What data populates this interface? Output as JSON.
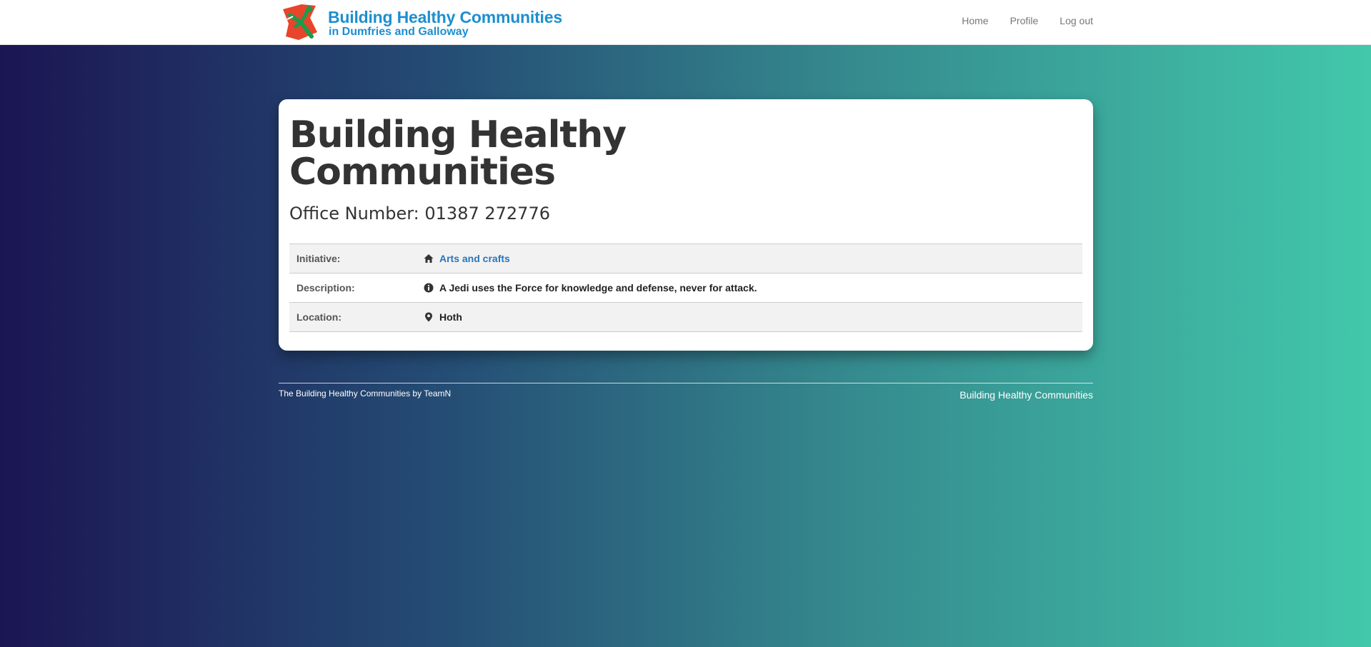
{
  "header": {
    "brand_line1": "Building Healthy Communities",
    "brand_line2": "in Dumfries and Galloway",
    "logo_icon": "leaping-figure-logo-icon",
    "nav": [
      "Home",
      "Profile",
      "Log out"
    ]
  },
  "main": {
    "title": "Building Healthy Communities",
    "office_number": "Office Number: 01387 272776",
    "rows": [
      {
        "label": "Initiative:",
        "icon": "home-icon",
        "value": "Arts and crafts",
        "is_link": true
      },
      {
        "label": "Description:",
        "icon": "info-circle-icon",
        "value": "A Jedi uses the Force for knowledge and defense, never for attack.",
        "is_link": false
      },
      {
        "label": "Location:",
        "icon": "map-marker-icon",
        "value": "Hoth",
        "is_link": false
      }
    ]
  },
  "footer": {
    "left": "The Building Healthy Communities by TeamN",
    "right": "Building Healthy Communities"
  },
  "colors": {
    "brand_blue": "#1c8fd0",
    "link_blue": "#2a75bb",
    "gradient": [
      "#1b1553",
      "#254e75",
      "#358a8e",
      "#42c8ab"
    ]
  }
}
